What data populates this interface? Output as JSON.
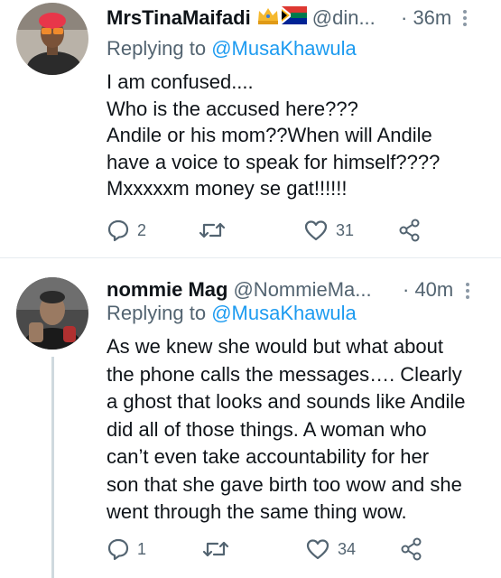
{
  "tweets": [
    {
      "display_name": "MrsTinaMaifadi",
      "badges": [
        "crown-emoji",
        "south-africa-flag-emoji"
      ],
      "handle": "@din...",
      "time": "· 36m",
      "replying_prefix": "Replying to",
      "replying_to": "@MusaKhawula",
      "lines": [
        "I am confused....",
        "Who is the accused here???",
        "Andile or his mom??When will Andile",
        "have a voice to speak for himself????",
        "Mxxxxxm money se gat!!!!!!"
      ],
      "reply_count": "2",
      "retweet_count": "",
      "like_count": "31"
    },
    {
      "display_name": "nommie Mag",
      "handle": "@NommieMa...",
      "time": "· 40m",
      "replying_prefix": "Replying to",
      "replying_to": "@MusaKhawula",
      "lines": [
        "As we knew she would but what about",
        "the phone calls the messages…. Clearly",
        "a ghost that looks and sounds like Andile",
        "did all of those things. A woman who",
        "can’t even take accountability for her",
        "son that she gave birth too wow and she",
        "went through the same thing wow."
      ],
      "reply_count": "1",
      "retweet_count": "",
      "like_count": "34"
    }
  ],
  "icons": {
    "reply": "speech-bubble-icon",
    "retweet": "retweet-arrows-icon",
    "like": "heart-outline-icon",
    "share": "share-nodes-icon",
    "more": "vertical-ellipsis-icon"
  },
  "colors": {
    "text": "#0f1419",
    "secondary": "#536471",
    "mention": "#1d9bf0",
    "divider": "#e6ecf0"
  }
}
